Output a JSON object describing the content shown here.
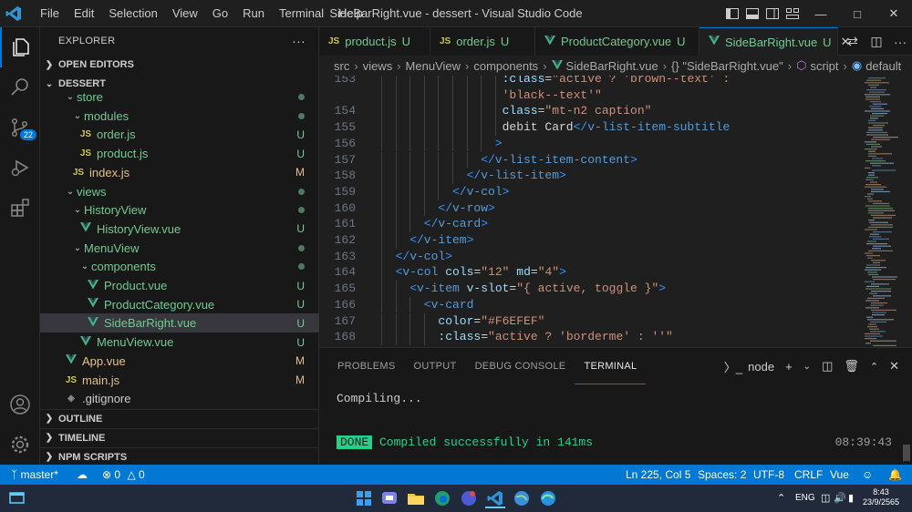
{
  "titlebar": {
    "menu": [
      "File",
      "Edit",
      "Selection",
      "View",
      "Go",
      "Run",
      "Terminal",
      "Help"
    ],
    "title": "SideBarRight.vue - dessert - Visual Studio Code"
  },
  "activity": {
    "scm_badge": "22"
  },
  "sidebar": {
    "header": "EXPLORER",
    "open_editors": "OPEN EDITORS",
    "project": "DESSERT",
    "items": [
      {
        "label": "store",
        "kind": "folder",
        "depth": 1,
        "status": "dot"
      },
      {
        "label": "modules",
        "kind": "folder",
        "depth": 2,
        "status": "dot"
      },
      {
        "label": "order.js",
        "kind": "js",
        "depth": 3,
        "status": "U"
      },
      {
        "label": "product.js",
        "kind": "js",
        "depth": 3,
        "status": "U"
      },
      {
        "label": "index.js",
        "kind": "js",
        "depth": 2,
        "status": "M"
      },
      {
        "label": "views",
        "kind": "folder",
        "depth": 1,
        "status": "dot"
      },
      {
        "label": "HistoryView",
        "kind": "folder",
        "depth": 2,
        "status": "dot"
      },
      {
        "label": "HistoryView.vue",
        "kind": "vue",
        "depth": 3,
        "status": "U"
      },
      {
        "label": "MenuView",
        "kind": "folder",
        "depth": 2,
        "status": "dot"
      },
      {
        "label": "components",
        "kind": "folder",
        "depth": 3,
        "status": "dot"
      },
      {
        "label": "Product.vue",
        "kind": "vue",
        "depth": 4,
        "status": "U"
      },
      {
        "label": "ProductCategory.vue",
        "kind": "vue",
        "depth": 4,
        "status": "U"
      },
      {
        "label": "SideBarRight.vue",
        "kind": "vue",
        "depth": 4,
        "status": "U",
        "selected": true
      },
      {
        "label": "MenuView.vue",
        "kind": "vue",
        "depth": 3,
        "status": "U"
      },
      {
        "label": "App.vue",
        "kind": "vue",
        "depth": 1,
        "status": "M"
      },
      {
        "label": "main.js",
        "kind": "js",
        "depth": 1,
        "status": "M"
      },
      {
        "label": ".gitignore",
        "kind": "git",
        "depth": 1,
        "status": ""
      }
    ],
    "outline": "OUTLINE",
    "timeline": "TIMELINE",
    "npm_scripts": "NPM SCRIPTS"
  },
  "tabs": [
    {
      "label": "product.js",
      "kind": "js",
      "status": "U"
    },
    {
      "label": "order.js",
      "kind": "js",
      "status": "U"
    },
    {
      "label": "ProductCategory.vue",
      "kind": "vue",
      "status": "U"
    },
    {
      "label": "SideBarRight.vue",
      "kind": "vue",
      "status": "U",
      "active": true
    }
  ],
  "breadcrumb": [
    "src",
    "views",
    "MenuView",
    "components",
    "SideBarRight.vue",
    "{} \"SideBarRight.vue\"",
    "script",
    "default"
  ],
  "code_lines": [
    {
      "n": "153",
      "indent": 17,
      "parts": [
        [
          "at",
          ":class"
        ],
        [
          "tx",
          "="
        ],
        [
          "st",
          "\"active ? 'brown--text' :"
        ]
      ]
    },
    {
      "n": "",
      "indent": 17,
      "parts": [
        [
          "st",
          "'black--text'\""
        ]
      ]
    },
    {
      "n": "154",
      "indent": 17,
      "parts": [
        [
          "at",
          "class"
        ],
        [
          "tx",
          "="
        ],
        [
          "st",
          "\"mt-n2 caption\""
        ]
      ]
    },
    {
      "n": "155",
      "indent": 17,
      "parts": [
        [
          "tx",
          "debit Card"
        ],
        [
          "tg",
          "</"
        ],
        [
          "tn",
          "v-list-item-subtitle"
        ]
      ]
    },
    {
      "n": "156",
      "indent": 16,
      "parts": [
        [
          "tg",
          ">"
        ]
      ]
    },
    {
      "n": "157",
      "indent": 14,
      "parts": [
        [
          "tg",
          "</"
        ],
        [
          "tn",
          "v-list-item-content"
        ],
        [
          "tg",
          ">"
        ]
      ]
    },
    {
      "n": "158",
      "indent": 12,
      "parts": [
        [
          "tg",
          "</"
        ],
        [
          "tn",
          "v-list-item"
        ],
        [
          "tg",
          ">"
        ]
      ]
    },
    {
      "n": "159",
      "indent": 10,
      "parts": [
        [
          "tg",
          "</"
        ],
        [
          "tn",
          "v-col"
        ],
        [
          "tg",
          ">"
        ]
      ]
    },
    {
      "n": "160",
      "indent": 8,
      "parts": [
        [
          "tg",
          "</"
        ],
        [
          "tn",
          "v-row"
        ],
        [
          "tg",
          ">"
        ]
      ]
    },
    {
      "n": "161",
      "indent": 6,
      "parts": [
        [
          "tg",
          "</"
        ],
        [
          "tn",
          "v-card"
        ],
        [
          "tg",
          ">"
        ]
      ]
    },
    {
      "n": "162",
      "indent": 4,
      "parts": [
        [
          "tg",
          "</"
        ],
        [
          "tn",
          "v-item"
        ],
        [
          "tg",
          ">"
        ]
      ]
    },
    {
      "n": "163",
      "indent": 2,
      "parts": [
        [
          "tg",
          "</"
        ],
        [
          "tn",
          "v-col"
        ],
        [
          "tg",
          ">"
        ]
      ]
    },
    {
      "n": "164",
      "indent": 2,
      "parts": [
        [
          "tg",
          "<"
        ],
        [
          "tn",
          "v-col "
        ],
        [
          "at",
          "cols"
        ],
        [
          "tx",
          "="
        ],
        [
          "st",
          "\"12\" "
        ],
        [
          "at",
          "md"
        ],
        [
          "tx",
          "="
        ],
        [
          "st",
          "\"4\""
        ],
        [
          "tg",
          ">"
        ]
      ]
    },
    {
      "n": "165",
      "indent": 4,
      "parts": [
        [
          "tg",
          "<"
        ],
        [
          "tn",
          "v-item "
        ],
        [
          "at",
          "v-slot"
        ],
        [
          "tx",
          "="
        ],
        [
          "st",
          "\"{ active, toggle }\""
        ],
        [
          "tg",
          ">"
        ]
      ]
    },
    {
      "n": "166",
      "indent": 6,
      "parts": [
        [
          "tg",
          "<"
        ],
        [
          "tn",
          "v-card"
        ]
      ]
    },
    {
      "n": "167",
      "indent": 8,
      "parts": [
        [
          "at",
          "color"
        ],
        [
          "tx",
          "="
        ],
        [
          "st",
          "\"#F6EFEF\""
        ]
      ]
    },
    {
      "n": "168",
      "indent": 8,
      "parts": [
        [
          "at",
          ":class"
        ],
        [
          "tx",
          "="
        ],
        [
          "st",
          "\"active ? 'borderme' : ''\""
        ]
      ]
    }
  ],
  "panel": {
    "tabs": [
      "PROBLEMS",
      "OUTPUT",
      "DEBUG CONSOLE",
      "TERMINAL"
    ],
    "terminal_label": "node",
    "compiling": "Compiling...",
    "done_badge": "DONE",
    "done_msg": "Compiled successfully in 141ms",
    "time": "08:39:43"
  },
  "statusbar": {
    "branch": "master*",
    "errors": "0",
    "warnings": "0",
    "position": "Ln 225, Col 5",
    "spaces": "Spaces: 2",
    "encoding": "UTF-8",
    "eol": "CRLF",
    "language": "Vue"
  },
  "taskbar": {
    "lang": "ENG",
    "time": "8:43",
    "date": "23/9/2565"
  },
  "colors": {
    "accent": "#0078d4",
    "untracked": "#73c991",
    "modified": "#e2c08d",
    "done_green": "#23d18b"
  }
}
